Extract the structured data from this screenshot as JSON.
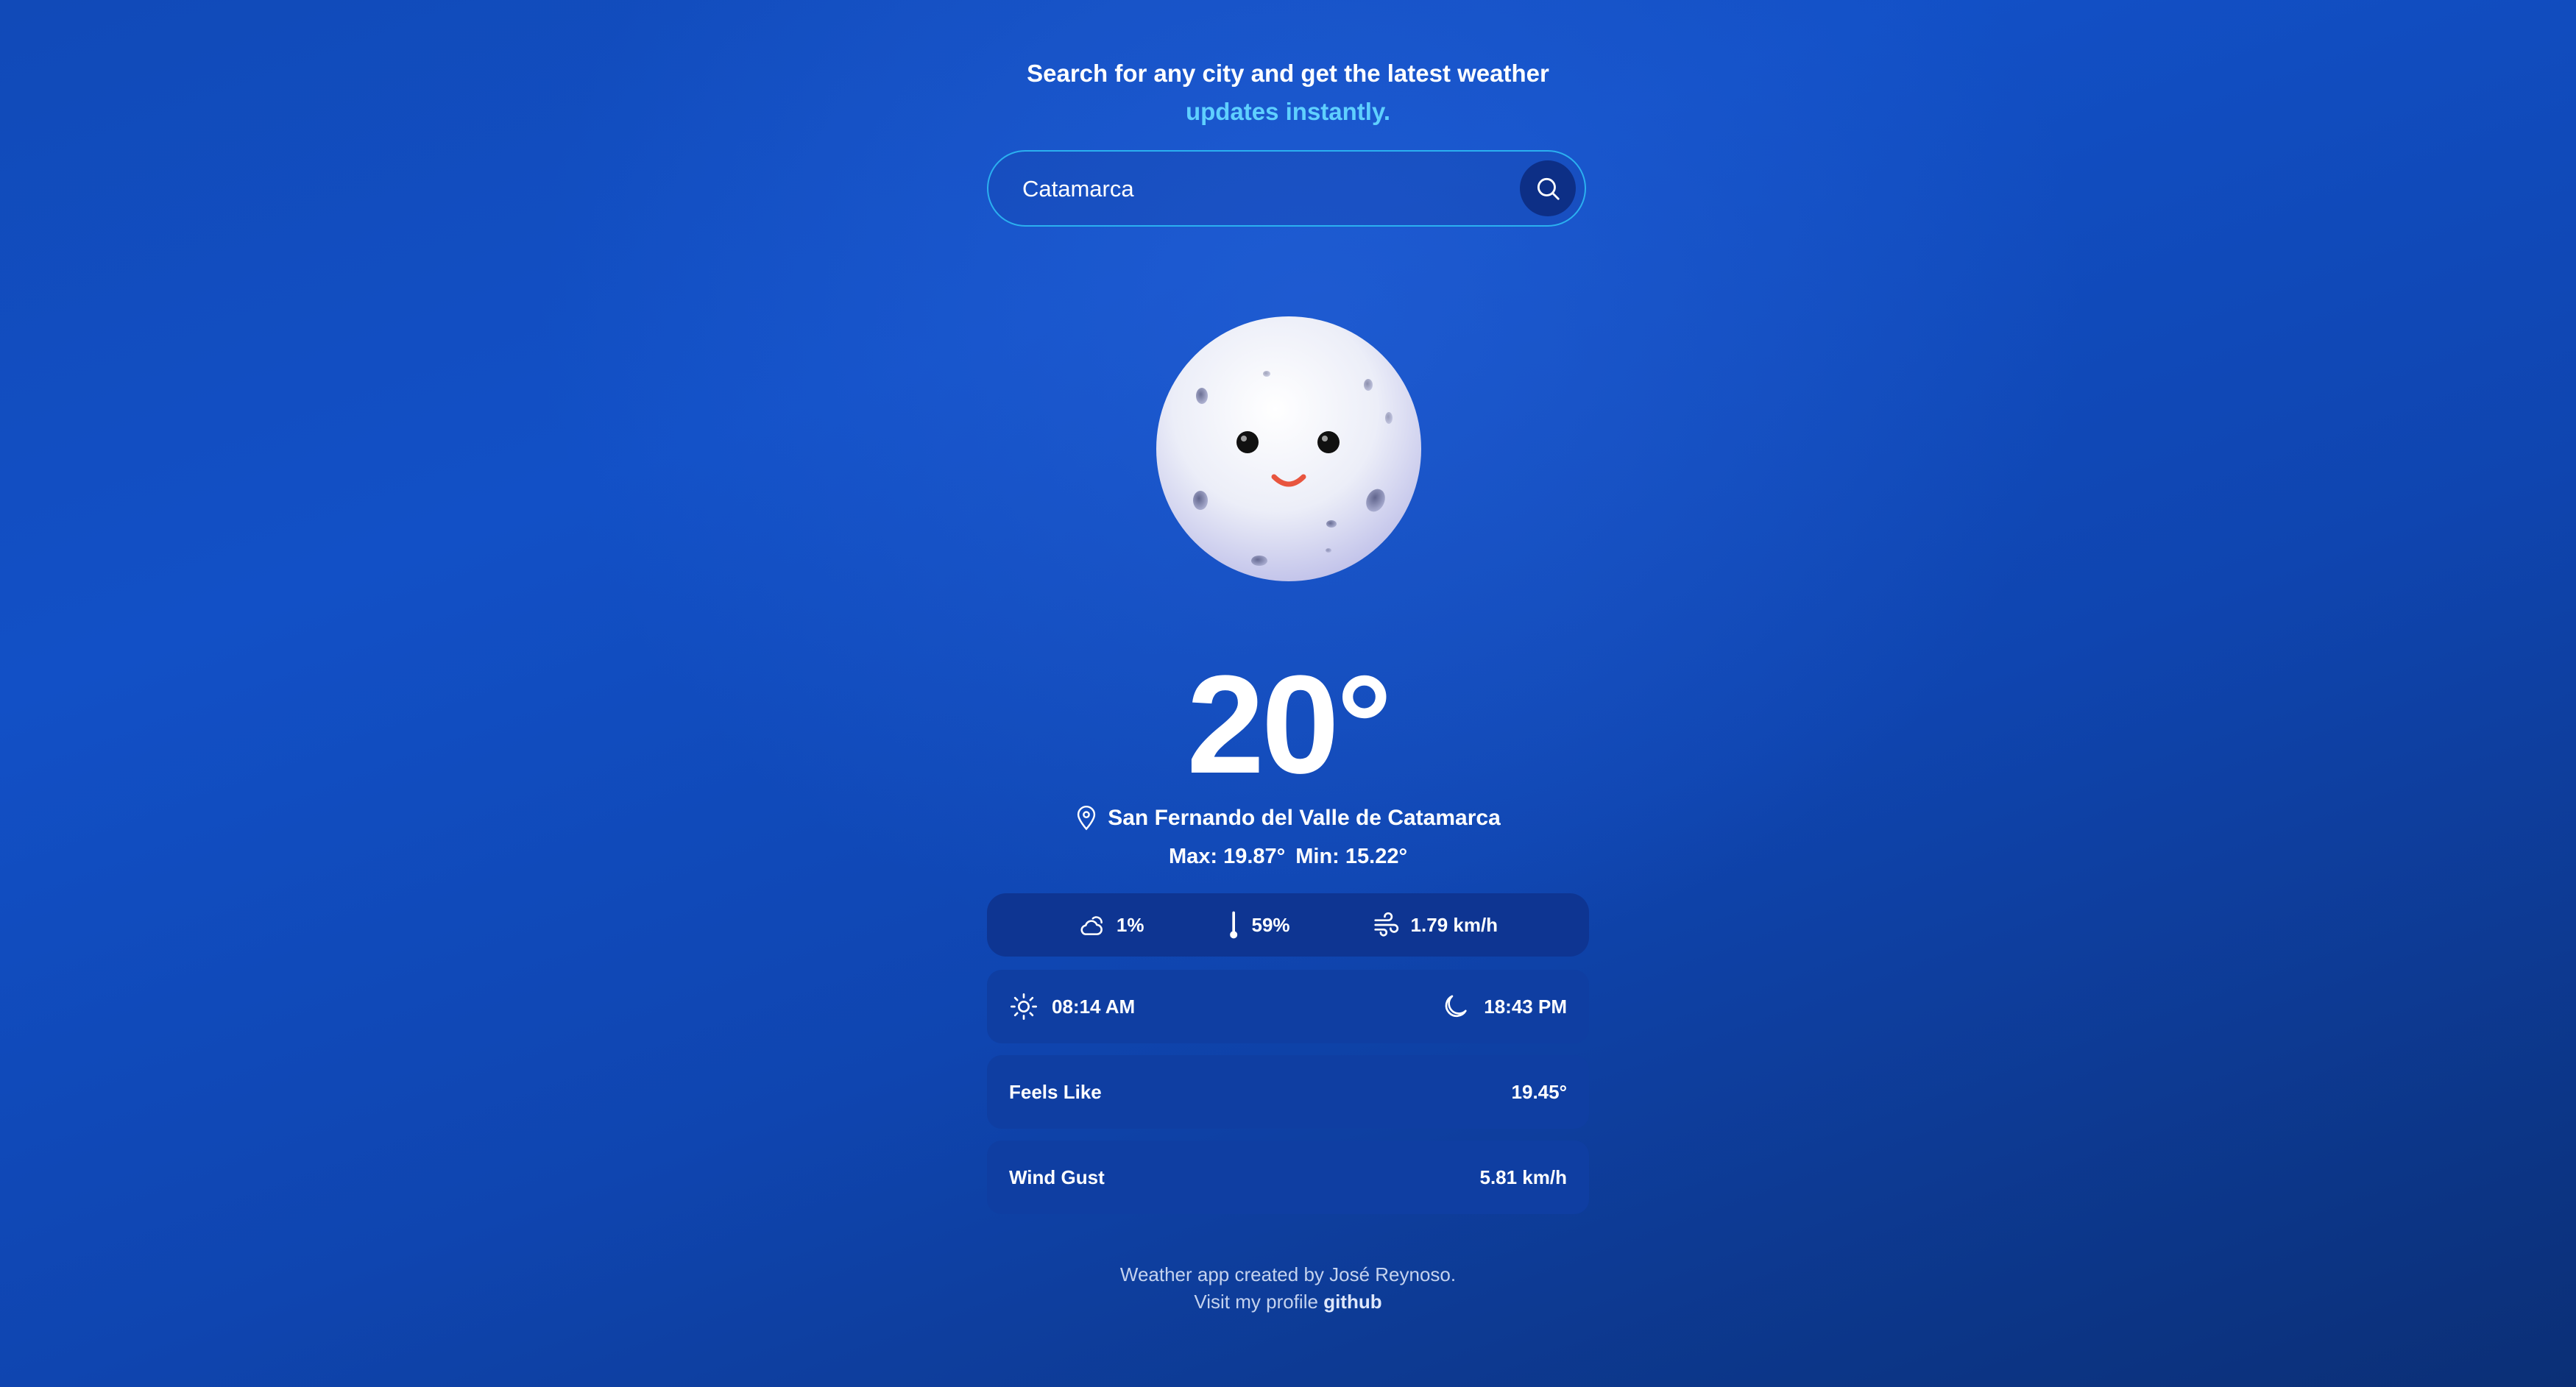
{
  "header": {
    "line1": "Search for any city and get the latest weather",
    "line2": "updates instantly."
  },
  "search": {
    "value": "Catamarca",
    "icon": "search-icon"
  },
  "weather": {
    "icon": "moon-face-icon",
    "temperature": "20°",
    "location": "San Fernando del Valle de Catamarca",
    "max": "Max: 19.87°",
    "min": "Min: 15.22°"
  },
  "stats": {
    "clouds": "1%",
    "humidity": "59%",
    "wind": "1.79 km/h"
  },
  "sun": {
    "sunrise": "08:14 AM",
    "sunset": "18:43 PM"
  },
  "details": {
    "feels_like_label": "Feels Like",
    "feels_like_value": "19.45°",
    "wind_gust_label": "Wind Gust",
    "wind_gust_value": "5.81 km/h"
  },
  "footer": {
    "credit": "Weather app created by José Reynoso.",
    "visit_text": "Visit my profile",
    "link_label": "github"
  },
  "colors": {
    "accent": "#5fd0ff",
    "border": "#2bb0f0",
    "card": "#0e3592"
  }
}
